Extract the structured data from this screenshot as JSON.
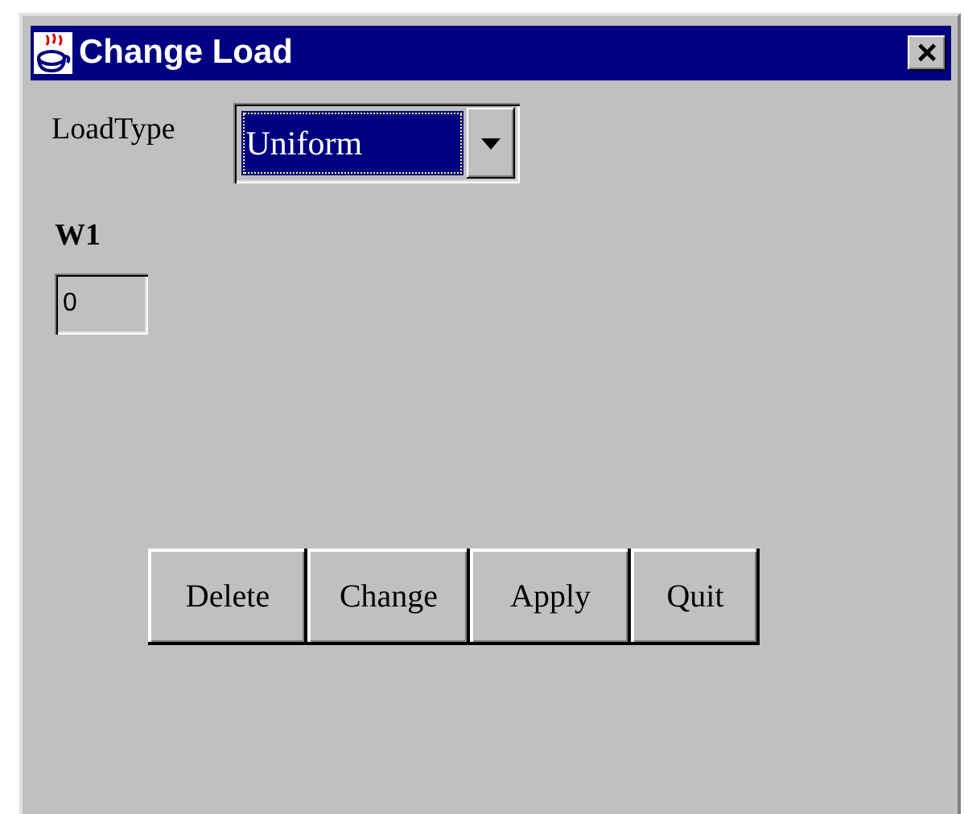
{
  "window": {
    "title": "Change Load",
    "close": "×"
  },
  "load_type": {
    "label": "LoadType",
    "value": "Uniform"
  },
  "w1": {
    "label": "W1",
    "value": "0"
  },
  "buttons": [
    "Delete",
    "Change",
    "Apply",
    "Quit"
  ]
}
